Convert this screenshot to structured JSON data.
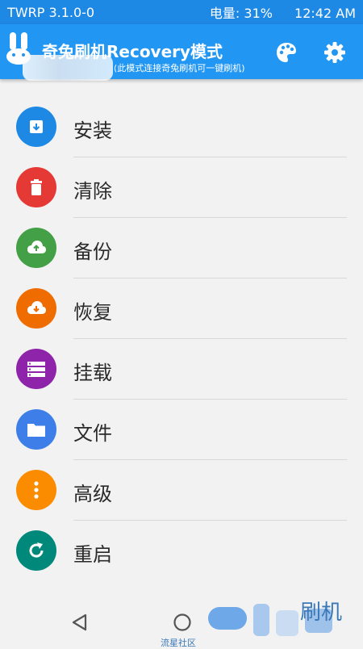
{
  "status_bar": {
    "app_version": "TWRP 3.1.0-0",
    "battery": "电量:  31%",
    "time": "12:42 AM"
  },
  "app_bar": {
    "title": "奇兔刷机Recovery模式",
    "subtitle": "(此模式连接奇兔刷机可一键刷机)",
    "actions": [
      "palette-icon",
      "gear-icon"
    ]
  },
  "menu": {
    "items": [
      {
        "label": "安装",
        "icon": "install-icon",
        "color": "#1e88e5"
      },
      {
        "label": "清除",
        "icon": "trash-icon",
        "color": "#e53935"
      },
      {
        "label": "备份",
        "icon": "cloud-upload-icon",
        "color": "#43a047"
      },
      {
        "label": "恢复",
        "icon": "cloud-download-icon",
        "color": "#ef6c00"
      },
      {
        "label": "挂载",
        "icon": "storage-icon",
        "color": "#8e24aa"
      },
      {
        "label": "文件",
        "icon": "folder-icon",
        "color": "#3d7ee8"
      },
      {
        "label": "高级",
        "icon": "more-vert-icon",
        "color": "#fb8c00"
      },
      {
        "label": "重启",
        "icon": "restart-icon",
        "color": "#00897b"
      }
    ]
  },
  "nav_bar": {
    "watermark_text": "流星社区",
    "watermark_glyph": "刷机"
  }
}
